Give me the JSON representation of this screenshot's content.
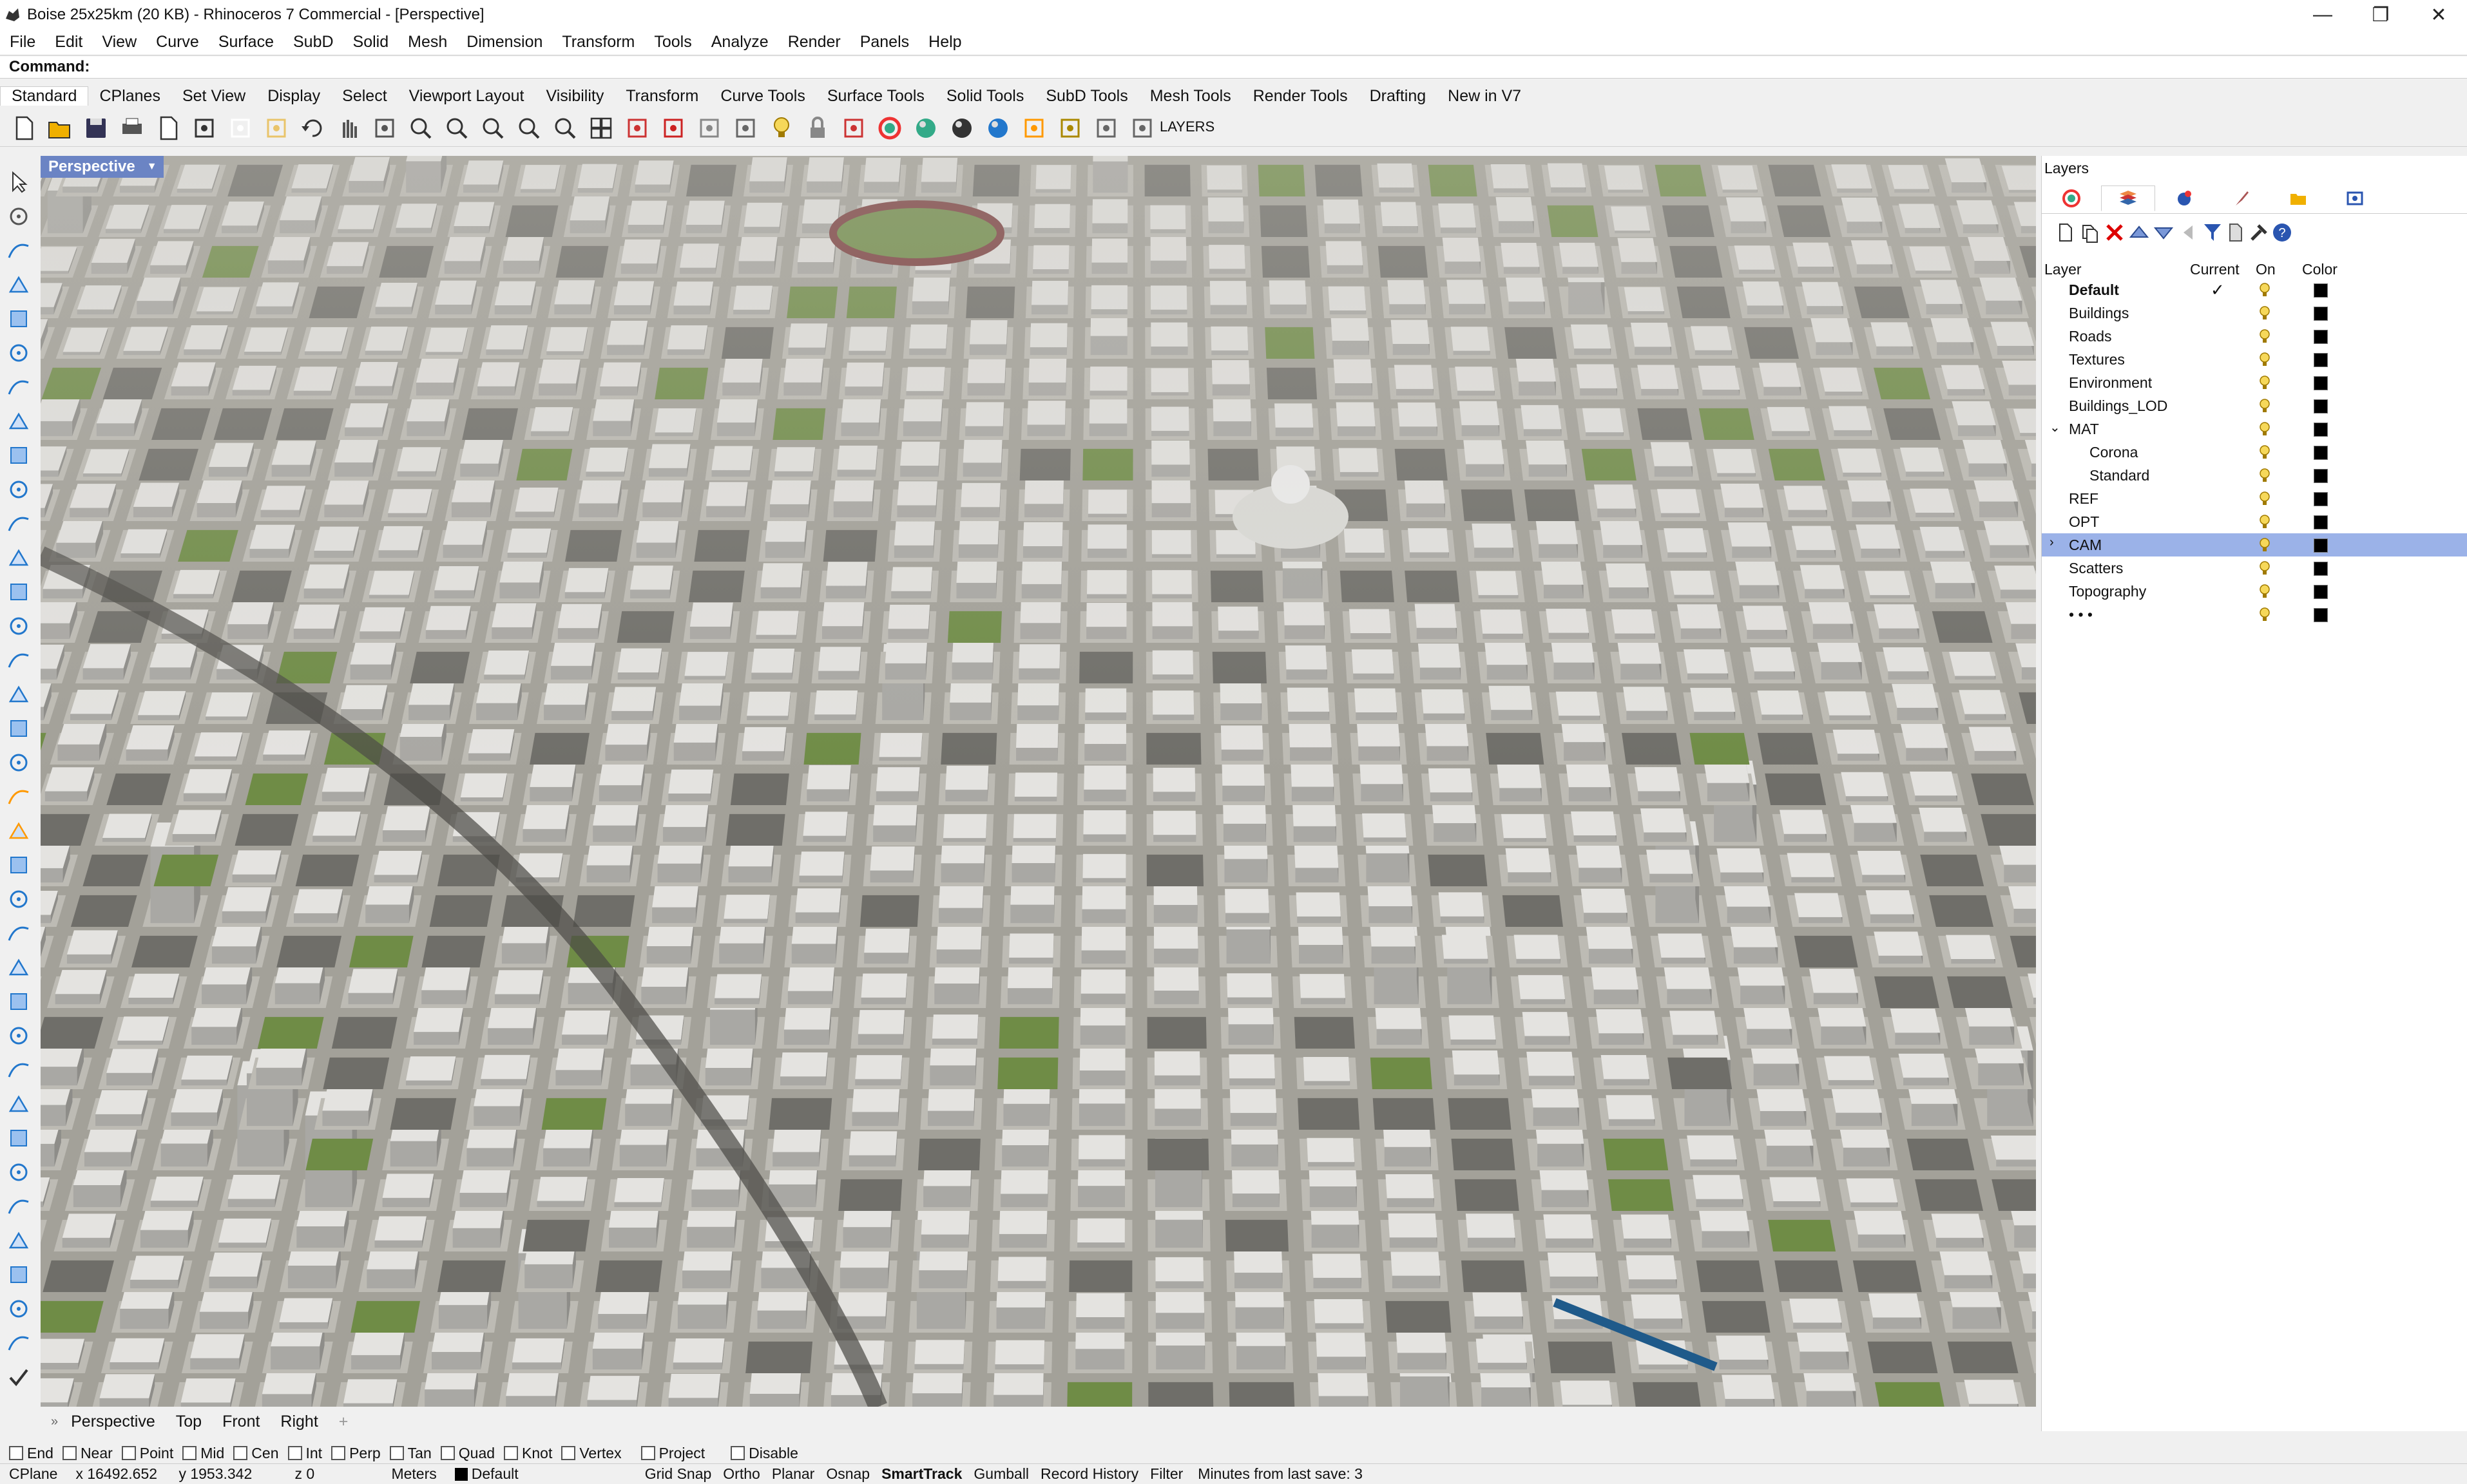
{
  "titlebar": {
    "title": "Boise 25x25km (20 KB) - Rhinoceros 7 Commercial - [Perspective]",
    "min": "—",
    "max": "❐",
    "close": "✕"
  },
  "menu": [
    "File",
    "Edit",
    "View",
    "Curve",
    "Surface",
    "SubD",
    "Solid",
    "Mesh",
    "Dimension",
    "Transform",
    "Tools",
    "Analyze",
    "Render",
    "Panels",
    "Help"
  ],
  "command": {
    "label": "Command:"
  },
  "toolbar_tabs": [
    "Standard",
    "CPlanes",
    "Set View",
    "Display",
    "Select",
    "Viewport Layout",
    "Visibility",
    "Transform",
    "Curve Tools",
    "Surface Tools",
    "Solid Tools",
    "SubD Tools",
    "Mesh Tools",
    "Render Tools",
    "Drafting",
    "New in V7"
  ],
  "toolbar": {
    "layers_label": "LAYERS"
  },
  "viewport": {
    "label": "Perspective"
  },
  "view_tabs": [
    "Perspective",
    "Top",
    "Front",
    "Right"
  ],
  "panel": {
    "title": "Layers",
    "columns": {
      "layer": "Layer",
      "current": "Current",
      "on": "On",
      "color": "Color"
    },
    "layers": [
      {
        "name": "Default",
        "current": true,
        "bold": true,
        "indent": 0
      },
      {
        "name": "Buildings",
        "indent": 0
      },
      {
        "name": "Roads",
        "indent": 0
      },
      {
        "name": "Textures",
        "indent": 0
      },
      {
        "name": "Environment",
        "indent": 0
      },
      {
        "name": "Buildings_LOD",
        "indent": 0
      },
      {
        "name": "MAT",
        "indent": 0,
        "expanded": true
      },
      {
        "name": "Corona",
        "indent": 1
      },
      {
        "name": "Standard",
        "indent": 1
      },
      {
        "name": "REF",
        "indent": 0
      },
      {
        "name": "OPT",
        "indent": 0
      },
      {
        "name": "CAM",
        "indent": 0,
        "selected": true,
        "collapsed": true
      },
      {
        "name": "Scatters",
        "indent": 0
      },
      {
        "name": "Topography",
        "indent": 0
      },
      {
        "name": "• • •",
        "indent": 0
      }
    ]
  },
  "osnaps": [
    {
      "label": "End",
      "checked": false
    },
    {
      "label": "Near",
      "checked": false
    },
    {
      "label": "Point",
      "checked": false
    },
    {
      "label": "Mid",
      "checked": false
    },
    {
      "label": "Cen",
      "checked": false
    },
    {
      "label": "Int",
      "checked": false
    },
    {
      "label": "Perp",
      "checked": false
    },
    {
      "label": "Tan",
      "checked": false
    },
    {
      "label": "Quad",
      "checked": false
    },
    {
      "label": "Knot",
      "checked": false
    },
    {
      "label": "Vertex",
      "checked": false
    },
    {
      "label": "Project",
      "checked": false
    },
    {
      "label": "Disable",
      "checked": false
    }
  ],
  "status": {
    "cplane": "CPlane",
    "x": "x 16492.652",
    "y": "y 1953.342",
    "z": "z 0",
    "units": "Meters",
    "layer": "Default",
    "toggles": [
      "Grid Snap",
      "Ortho",
      "Planar",
      "Osnap",
      "SmartTrack",
      "Gumball",
      "Record History",
      "Filter"
    ],
    "active_toggle": "SmartTrack",
    "save": "Minutes from last save: 3"
  },
  "colors": {
    "selection": "#9bb2e8",
    "viewport_label": "#6b84c4",
    "park": "#6f8c46",
    "building": "#d8d8d6",
    "ground": "#9c9a93"
  }
}
